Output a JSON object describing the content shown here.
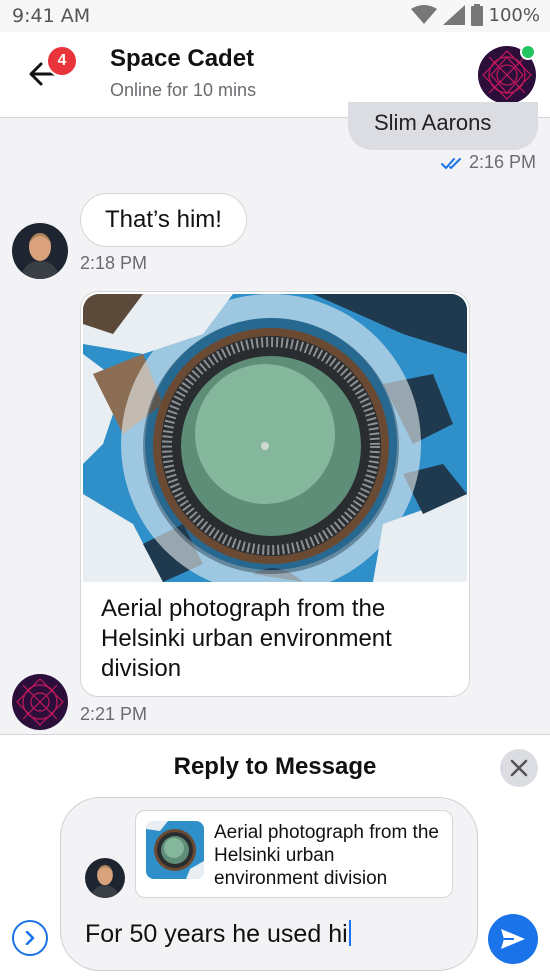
{
  "status_bar": {
    "time": "9:41 AM",
    "battery": "100%"
  },
  "header": {
    "unread_count": "4",
    "contact_name": "Space Cadet",
    "contact_status": "Online for 10 mins"
  },
  "messages": [
    {
      "direction": "outgoing",
      "text": "Slim Aarons",
      "time": "2:16 PM",
      "status": "read"
    },
    {
      "direction": "incoming",
      "text": "That’s him!",
      "time": "2:18 PM"
    },
    {
      "direction": "incoming",
      "type": "image",
      "caption": "Aerial photograph from the Helsinki urban environment division",
      "time": "2:21 PM"
    }
  ],
  "reply": {
    "title": "Reply to Message",
    "quoted_text": "Aerial photograph from the Helsinki urban environment division",
    "draft_text": "For 50 years he used hi"
  },
  "colors": {
    "accent": "#1a73e8",
    "badge": "#e8343a",
    "online": "#22c55e"
  }
}
